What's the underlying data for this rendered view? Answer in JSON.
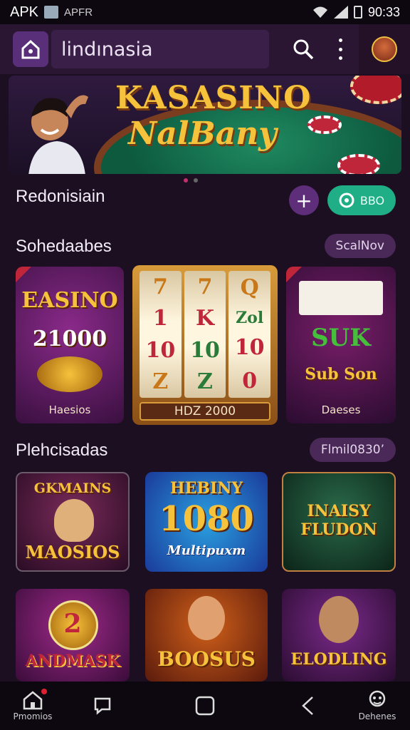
{
  "status": {
    "left1": "APK",
    "left2": "APFR",
    "time": "90:33"
  },
  "appbar": {
    "title": "lindınasia"
  },
  "banner": {
    "line1": "KASASINO",
    "line2": "NalBany"
  },
  "row1": {
    "label": "Redonisiain",
    "pill": "BBO"
  },
  "section1": {
    "label": "Sohedaabes",
    "tag": "ScalNov"
  },
  "cards1": [
    {
      "title": "EASINO",
      "value": "21000",
      "foot": "Haesios"
    },
    {
      "reels": [
        [
          "7",
          "1",
          "10",
          "Z"
        ],
        [
          "7",
          "K",
          "10",
          "Z"
        ],
        [
          "Q",
          "Zol",
          "10",
          "0"
        ]
      ],
      "foot": "HDZ 2000"
    },
    {
      "title": "SUK",
      "sub": "Sub Son",
      "foot": "Daeses"
    }
  ],
  "section2": {
    "label": "Plehcisadas",
    "tag": "Flmil0830’"
  },
  "cards2": [
    {
      "t1": "GKMAINS",
      "t2": "MAOSIOS"
    },
    {
      "t1": "HEBINY",
      "t2": "1080",
      "t3": "Multipuxm"
    },
    {
      "t1": "INAISY",
      "t2": "FLUDON"
    }
  ],
  "cards3": [
    {
      "t1": "2",
      "t2": "ANDMASK"
    },
    {
      "t2": "BOOSUS"
    },
    {
      "t2": "ELODLING"
    }
  ],
  "nav": {
    "home": "Pmomios",
    "profile": "Dehenes"
  },
  "colors": {
    "accent": "#5e2e7a",
    "green": "#1fae86",
    "gold": "#f6c23b"
  }
}
